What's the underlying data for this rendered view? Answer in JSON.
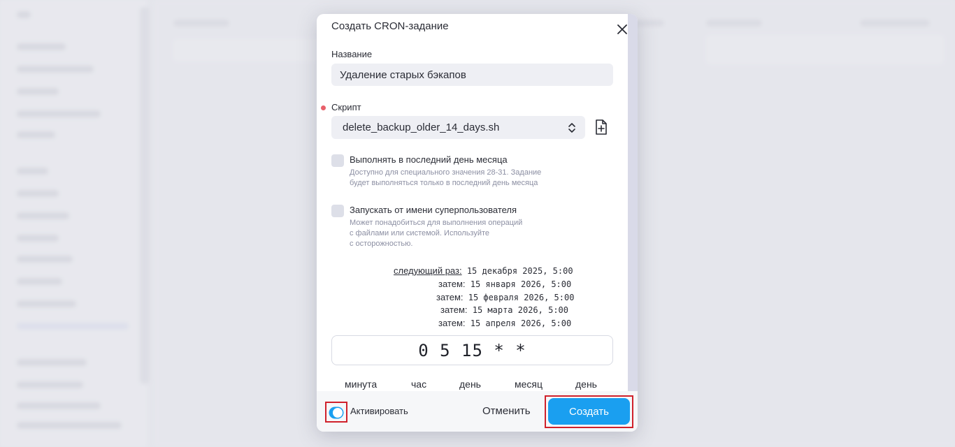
{
  "modal": {
    "title": "Создать CRON-задание",
    "name_label": "Название",
    "name_value": "Удаление старых бэкапов",
    "script_label": "Скрипт",
    "script_value": "delete_backup_older_14_days.sh",
    "last_day_label": "Выполнять в последний день месяца",
    "last_day_hint": "Доступно для специального значения 28-31. Задание\nбудет выполняться только в последний день месяца",
    "superuser_label": "Запускать от имени суперпользователя",
    "superuser_hint": "Может понадобиться для выполнения операций\nс файлами или системой. Используйте\nс осторожностью.",
    "schedule": [
      {
        "label": "следующий раз:",
        "value": "15 декабря 2025, 5:00"
      },
      {
        "label": "затем:",
        "value": "15 января 2026, 5:00"
      },
      {
        "label": "затем:",
        "value": "15 февраля 2026, 5:00"
      },
      {
        "label": "затем:",
        "value": "15 марта 2026, 5:00"
      },
      {
        "label": "затем:",
        "value": "15 апреля 2026, 5:00"
      }
    ],
    "cron_expression": "0 5 15 * *",
    "cron_fields": [
      "минута",
      "час",
      "день",
      "месяц",
      "день"
    ],
    "activate_label": "Активировать",
    "activate_on": true,
    "cancel_label": "Отменить",
    "create_label": "Создать"
  },
  "colors": {
    "accent": "#1a9ff0",
    "highlight": "#d0212b",
    "required": "#e8606a"
  }
}
